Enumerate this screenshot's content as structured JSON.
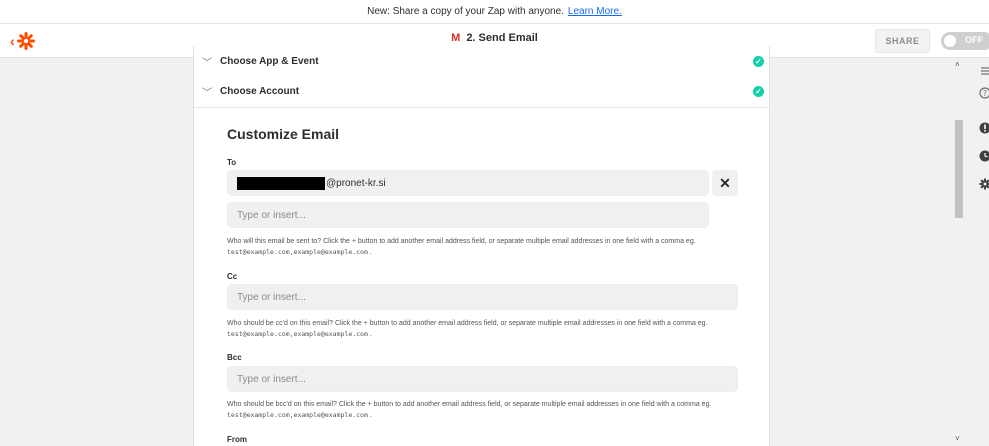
{
  "banner": {
    "text": "New: Share a copy of your Zap with anyone.",
    "link": "Learn More."
  },
  "header": {
    "step_title": "2. Send Email",
    "app_icon": "gmail-icon",
    "share_label": "SHARE",
    "toggle_label": "OFF"
  },
  "sections": [
    {
      "label": "Choose App & Event",
      "status": "complete"
    },
    {
      "label": "Choose Account",
      "status": "complete"
    }
  ],
  "form": {
    "title": "Customize Email",
    "to": {
      "label": "To",
      "value": "@pronet-kr.si",
      "placeholder": "Type or insert...",
      "help": "Who will this email be sent to? Click the + button to add another email address field, or separate multiple email addresses in one field with a comma eg.",
      "example": "test@example.com,example@example.com"
    },
    "cc": {
      "label": "Cc",
      "placeholder": "Type or insert...",
      "help": "Who should be cc'd on this email? Click the + button to add another email address field, or separate multiple email addresses in one field with a comma eg.",
      "example": "test@example.com,example@example.com"
    },
    "bcc": {
      "label": "Bcc",
      "placeholder": "Type or insert...",
      "help": "Who should be bcc'd on this email? Click the + button to add another email address field, or separate multiple email addresses in one field with a comma eg.",
      "example": "test@example.com,example@example.com"
    },
    "from": {
      "label": "From"
    }
  },
  "colors": {
    "brand": "#ff4a00",
    "success": "#13d0ab",
    "link": "#136bf5"
  },
  "rail_icons": [
    "list-icon",
    "help-icon",
    "alert-icon",
    "clock-icon",
    "gear-icon"
  ]
}
